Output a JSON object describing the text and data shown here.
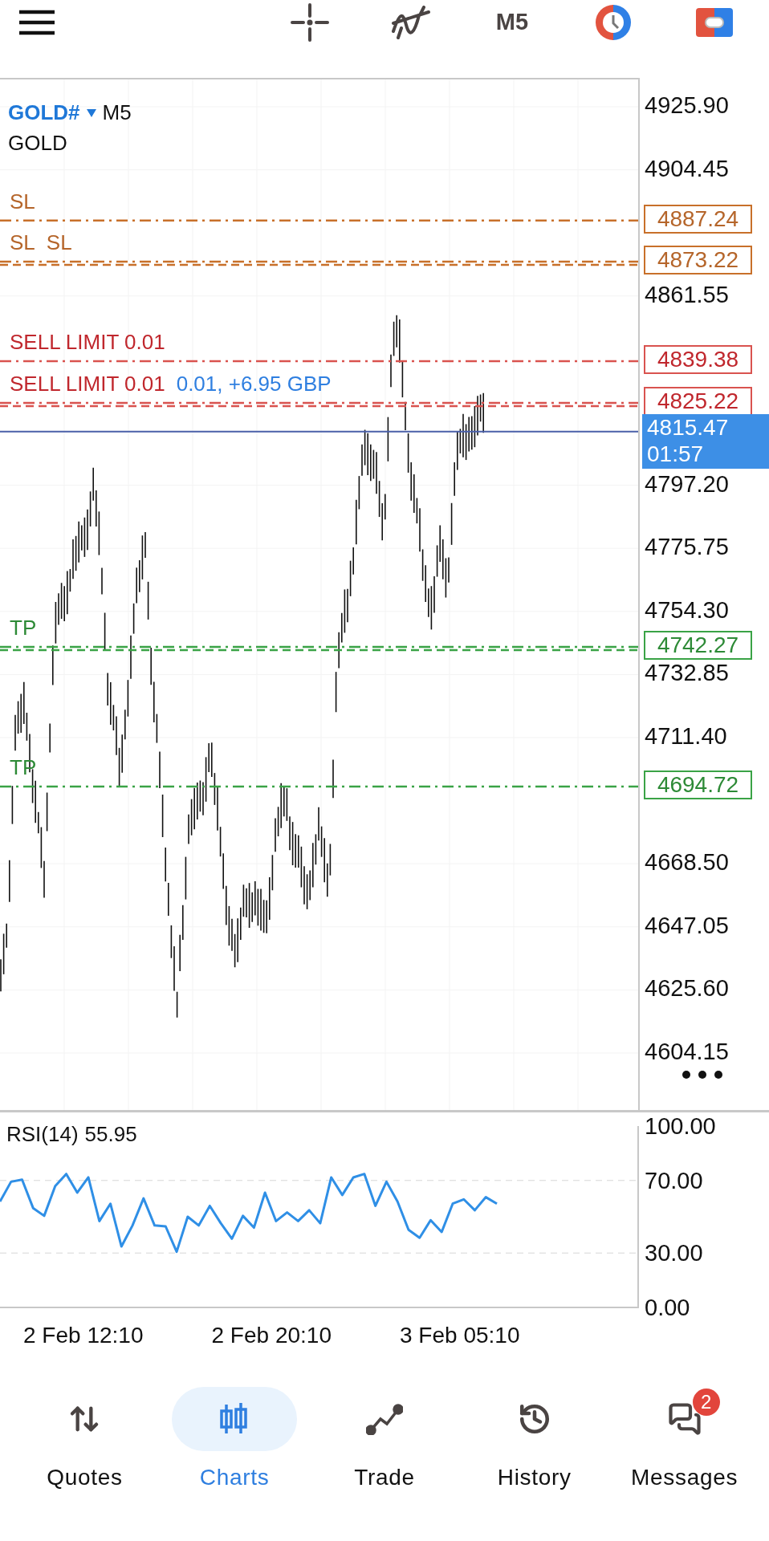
{
  "toolbar": {
    "timeframe": "M5"
  },
  "chart": {
    "symbol": "GOLD#",
    "timeframe": "M5",
    "description": "GOLD",
    "price_ticks": [
      "4925.90",
      "4904.45",
      "4861.55",
      "4797.20",
      "4775.75",
      "4754.30",
      "4732.85",
      "4711.40",
      "4668.50",
      "4647.05",
      "4625.60",
      "4604.15"
    ],
    "order_lines": [
      {
        "kind": "sl",
        "labels": [
          "SL"
        ],
        "price": "4887.24",
        "double": false
      },
      {
        "kind": "sl",
        "labels": [
          "SL",
          "SL"
        ],
        "price": "4873.22",
        "double": true
      },
      {
        "kind": "sell_limit",
        "labels": [
          "SELL LIMIT 0.01"
        ],
        "price": "4839.38",
        "double": false
      },
      {
        "kind": "sell_limit",
        "labels": [
          "SELL LIMIT 0.01"
        ],
        "price": "4825.22",
        "double": true,
        "note": "0.01, +6.95 GBP"
      },
      {
        "kind": "tp",
        "labels": [
          "TP"
        ],
        "price": "4742.27",
        "double": true
      },
      {
        "kind": "tp",
        "labels": [
          "TP"
        ],
        "price": "4694.72",
        "double": false
      }
    ],
    "current_price": {
      "price": "4815.47",
      "countdown": "01:57"
    }
  },
  "rsi": {
    "reading": "55.95",
    "chart_data": {
      "type": "line",
      "ylim": [
        0,
        100
      ],
      "yticks": [
        {
          "value": 100,
          "label": "100.00"
        },
        {
          "value": 70,
          "label": "70.00"
        },
        {
          "value": 30,
          "label": "30.00"
        },
        {
          "value": 0,
          "label": "0.00"
        }
      ],
      "series": [
        {
          "name": "RSI(14)",
          "color": "#2f8fe6",
          "values": [
            58.4,
            69.3,
            70.5,
            54.8,
            50.5,
            66.9,
            73.6,
            63.3,
            71.7,
            47.6,
            57.2,
            33.6,
            45.2,
            60.1,
            45.2,
            44.7,
            30.7,
            50.0,
            45.2,
            56.0,
            46.4,
            37.9,
            50.5,
            44.0,
            63.3,
            47.6,
            52.4,
            47.6,
            53.6,
            46.4,
            71.7,
            62.0,
            71.7,
            73.6,
            56.0,
            69.3,
            58.4,
            42.8,
            38.4,
            48.1,
            41.6,
            57.2,
            59.6,
            53.6,
            60.8,
            57.2
          ]
        }
      ]
    }
  },
  "time_axis": [
    "2 Feb 12:10",
    "2 Feb 20:10",
    "3 Feb 05:10"
  ],
  "bottom_nav": [
    {
      "kind": "quotes",
      "label": "Quotes",
      "selected": false
    },
    {
      "kind": "charts",
      "label": "Charts",
      "selected": true
    },
    {
      "kind": "trade",
      "label": "Trade",
      "selected": false
    },
    {
      "kind": "history",
      "label": "History",
      "selected": false
    },
    {
      "kind": "messages",
      "label": "Messages",
      "selected": false,
      "badge": "2"
    }
  ]
}
